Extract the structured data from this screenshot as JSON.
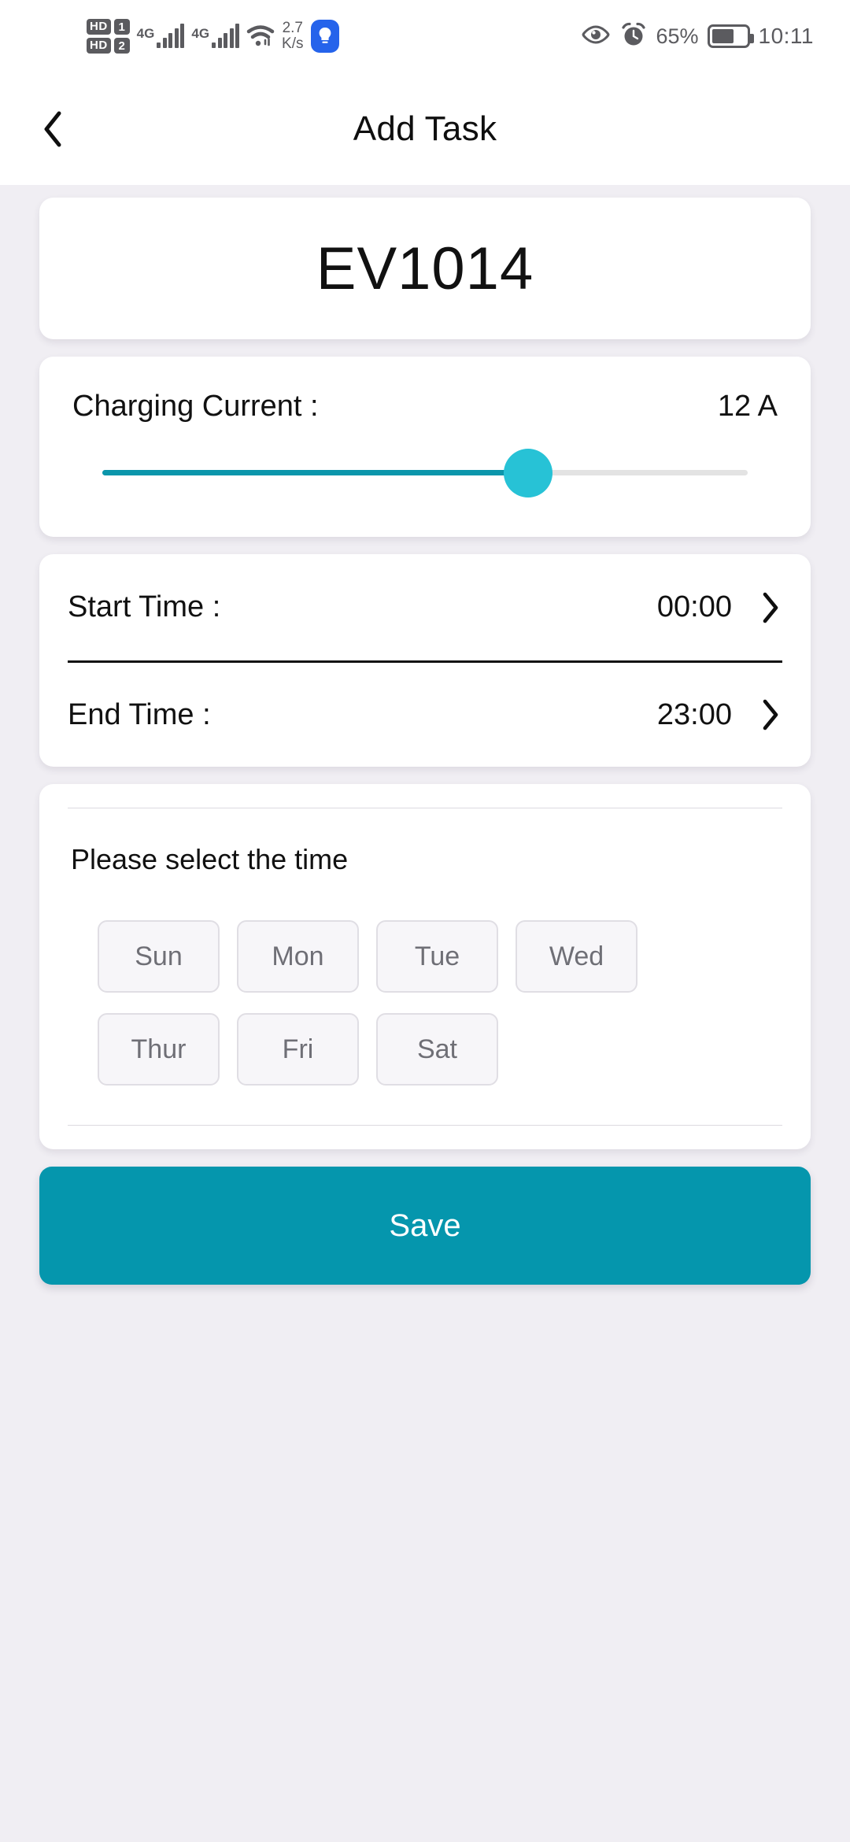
{
  "status_bar": {
    "hd1_label": "HD",
    "hd1_sim": "1",
    "hd2_label": "HD",
    "hd2_sim": "2",
    "net1": "4G",
    "net2": "4G",
    "wifi_icon": "wifi-icon",
    "data_speed_value": "2.7",
    "data_speed_unit": "K/s",
    "app_icon": "bulb-icon",
    "eye_icon": "eye-comfort-icon",
    "alarm_icon": "alarm-icon",
    "battery_percent": "65%",
    "battery_level": 65,
    "clock": "10:11"
  },
  "app_bar": {
    "back_icon": "chevron-left-icon",
    "title": "Add Task"
  },
  "device": {
    "name": "EV1014"
  },
  "charging_current": {
    "label": "Charging Current :",
    "value": "12 A",
    "slider_percent": 66,
    "track_color": "#e3e3e3",
    "fill_color": "#0b96ab",
    "thumb_color": "#27c2d6"
  },
  "times": [
    {
      "label": "Start Time :",
      "value": "00:00",
      "chevron": "chevron-right-icon"
    },
    {
      "label": "End Time :",
      "value": "23:00",
      "chevron": "chevron-right-icon"
    }
  ],
  "day_picker": {
    "hint": "Please select the time",
    "rows": [
      [
        "Sun",
        "Mon",
        "Tue",
        "Wed"
      ],
      [
        "Thur",
        "Fri",
        "Sat"
      ]
    ]
  },
  "save": {
    "label": "Save",
    "color": "#0596ad"
  }
}
